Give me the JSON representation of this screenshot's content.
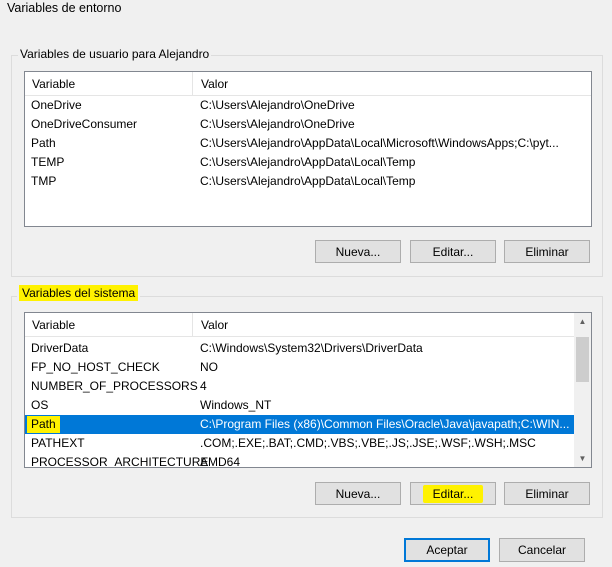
{
  "window": {
    "title": "Variables de entorno"
  },
  "user_vars": {
    "group_label": "Variables de usuario para Alejandro",
    "columns": [
      "Variable",
      "Valor"
    ],
    "rows": [
      {
        "variable": "OneDrive",
        "value": "C:\\Users\\Alejandro\\OneDrive"
      },
      {
        "variable": "OneDriveConsumer",
        "value": "C:\\Users\\Alejandro\\OneDrive"
      },
      {
        "variable": "Path",
        "value": "C:\\Users\\Alejandro\\AppData\\Local\\Microsoft\\WindowsApps;C:\\pyt..."
      },
      {
        "variable": "TEMP",
        "value": "C:\\Users\\Alejandro\\AppData\\Local\\Temp"
      },
      {
        "variable": "TMP",
        "value": "C:\\Users\\Alejandro\\AppData\\Local\\Temp"
      }
    ],
    "buttons": {
      "new": "Nueva...",
      "edit": "Editar...",
      "delete": "Eliminar"
    }
  },
  "system_vars": {
    "group_label": "Variables del sistema",
    "columns": [
      "Variable",
      "Valor"
    ],
    "rows": [
      {
        "variable": "DriverData",
        "value": "C:\\Windows\\System32\\Drivers\\DriverData"
      },
      {
        "variable": "FP_NO_HOST_CHECK",
        "value": "NO"
      },
      {
        "variable": "NUMBER_OF_PROCESSORS",
        "value": "4"
      },
      {
        "variable": "OS",
        "value": "Windows_NT"
      },
      {
        "variable": "Path",
        "value": "C:\\Program Files (x86)\\Common Files\\Oracle\\Java\\javapath;C:\\WIN..."
      },
      {
        "variable": "PATHEXT",
        "value": ".COM;.EXE;.BAT;.CMD;.VBS;.VBE;.JS;.JSE;.WSF;.WSH;.MSC"
      },
      {
        "variable": "PROCESSOR_ARCHITECTURE",
        "value": "AMD64"
      }
    ],
    "selected_index": 4,
    "buttons": {
      "new": "Nueva...",
      "edit": "Editar...",
      "delete": "Eliminar"
    }
  },
  "dialog_buttons": {
    "ok": "Aceptar",
    "cancel": "Cancelar"
  },
  "colors": {
    "selection": "#0078d7",
    "highlighter": "#fff200",
    "accent_border": "#0078d7"
  }
}
